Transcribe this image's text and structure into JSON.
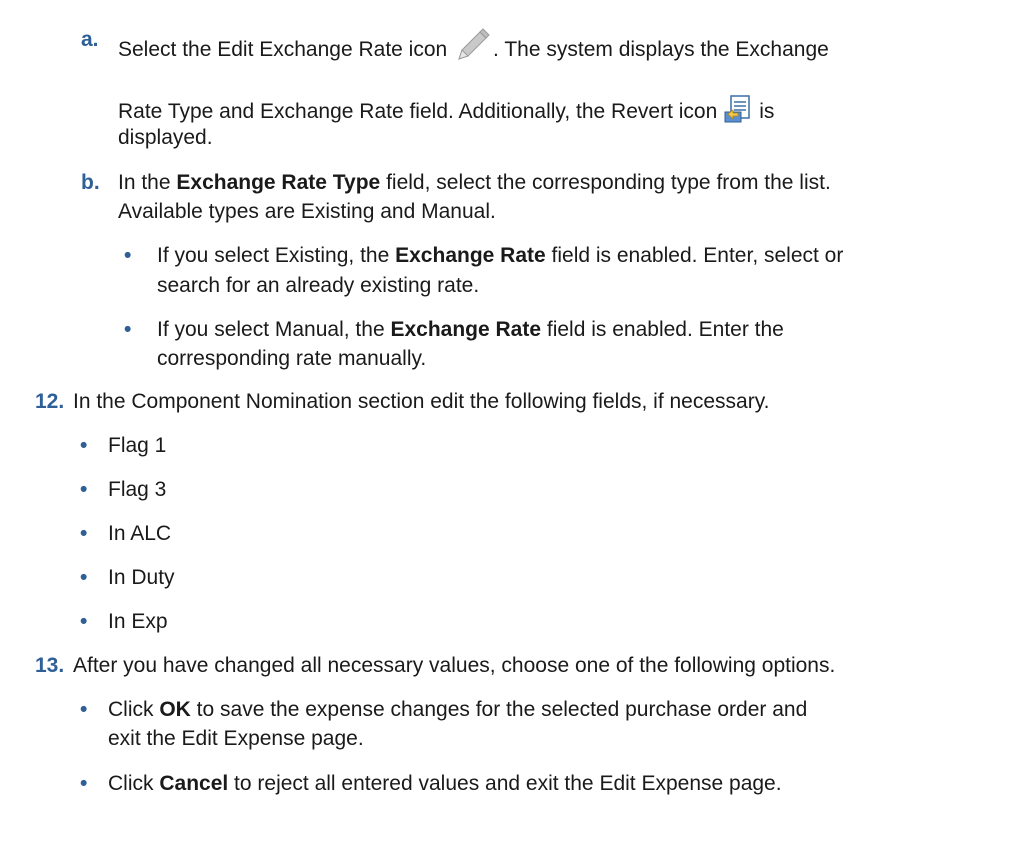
{
  "step_a": {
    "marker": "a.",
    "part1": "Select the Edit Exchange Rate icon",
    "part2": ". The system displays the Exchange",
    "line2a": "Rate Type and Exchange Rate field. Additionally, the Revert icon",
    "line2b": "is",
    "line3": "displayed.",
    "icon_edit": "pencil-icon",
    "icon_revert": "revert-icon"
  },
  "step_b": {
    "marker": "b.",
    "line1_pre": "In the ",
    "line1_bold": "Exchange Rate Type",
    "line1_post": " field, select the corresponding type from the list.",
    "line2": "Available types are Existing and Manual.",
    "bullets": [
      {
        "l1_pre": "If you select Existing, the ",
        "l1_bold": "Exchange Rate",
        "l1_post": " field is enabled. Enter, select or",
        "l2": "search for an already existing rate."
      },
      {
        "l1_pre": "If you select Manual, the ",
        "l1_bold": "Exchange Rate",
        "l1_post": " field is enabled. Enter the",
        "l2": "corresponding rate manually."
      }
    ]
  },
  "step_12": {
    "marker": "12.",
    "text": "In the Component Nomination section edit the following fields, if necessary.",
    "items": [
      "Flag 1",
      "Flag 3",
      "In ALC",
      "In Duty",
      "In Exp"
    ]
  },
  "step_13": {
    "marker": "13.",
    "text": "After you have changed all necessary values, choose one of the following options.",
    "bullets": [
      {
        "pre": "Click ",
        "bold": "OK",
        "post": " to save the expense changes for the selected purchase order and",
        "l2": "exit the Edit Expense page."
      },
      {
        "pre": "Click ",
        "bold": "Cancel",
        "post": " to reject all entered values and exit the Edit Expense page."
      }
    ]
  },
  "bullet_glyph": "•",
  "colors": {
    "marker": "#2e5f97",
    "text": "#1a1a1a"
  }
}
